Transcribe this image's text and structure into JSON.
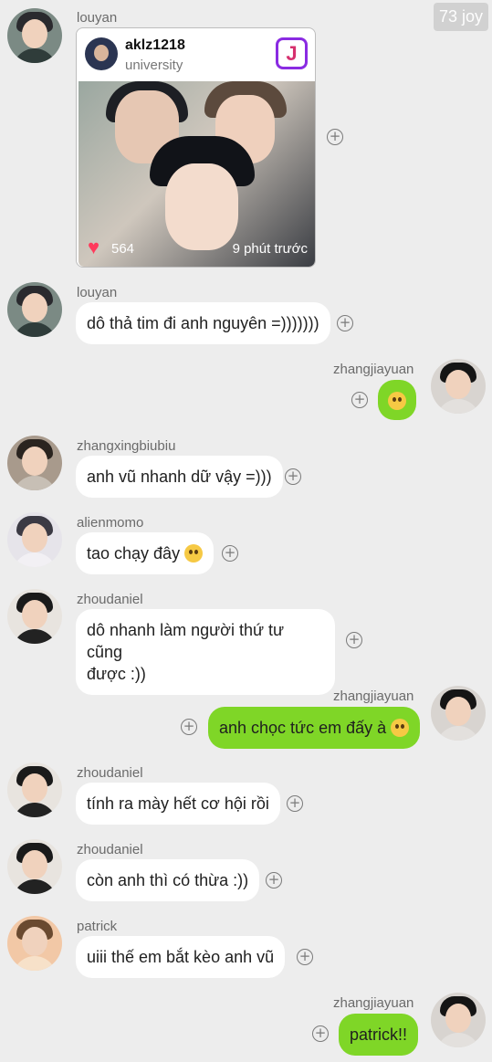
{
  "watermark": "73 joy",
  "post_card": {
    "username": "aklz1218",
    "subtitle": "university",
    "logo_letter": "J",
    "likes": "564",
    "time": "9 phút trước"
  },
  "messages": [
    {
      "sender": "louyan",
      "text": ""
    },
    {
      "sender": "louyan",
      "text": "dô thả tim đi anh nguyên =)))))))"
    },
    {
      "sender": "zhangjiayuan",
      "text": ""
    },
    {
      "sender": "zhangxingbiubiu",
      "text": "anh vũ nhanh dữ vậy =)))"
    },
    {
      "sender": "alienmomo",
      "text": "tao chạy đây"
    },
    {
      "sender": "zhoudaniel",
      "text": "dô nhanh làm người thứ tư cũng",
      "text2": "được :))"
    },
    {
      "sender": "zhangjiayuan",
      "text": "anh chọc tức em đấy à"
    },
    {
      "sender": "zhoudaniel",
      "text": "tính ra mày hết cơ hội rồi"
    },
    {
      "sender": "zhoudaniel",
      "text": "còn anh thì có thừa :))"
    },
    {
      "sender": "patrick",
      "text": "uiii thế em bắt kèo anh vũ"
    },
    {
      "sender": "zhangjiayuan",
      "text": "patrick!!"
    }
  ],
  "plus_symbol": "+"
}
